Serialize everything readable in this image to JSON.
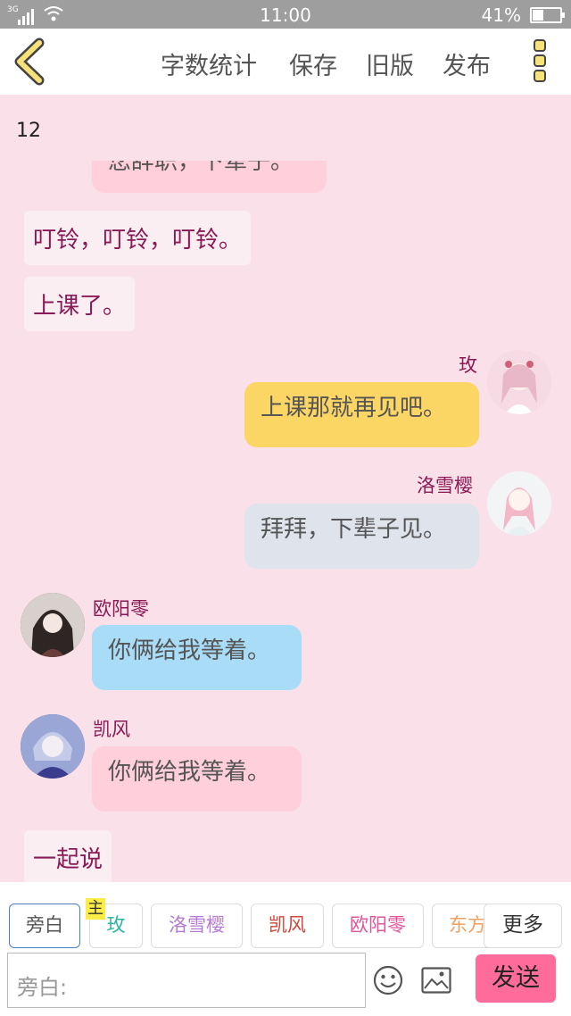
{
  "status_bar": {
    "network": "3G",
    "time": "11:00",
    "battery": "41%",
    "battery_level": 0.41
  },
  "toolbar": {
    "word_count": "字数统计",
    "save": "保存",
    "old_version": "旧版",
    "publish": "发布"
  },
  "counter": "12",
  "messages": [
    {
      "kind": "bubble_clipped",
      "text": "您辞职，下辈子。"
    },
    {
      "kind": "narration",
      "text": "叮铃，叮铃，叮铃。"
    },
    {
      "kind": "narration",
      "text": "上课了。"
    },
    {
      "kind": "right",
      "name": "玫",
      "text": "上课那就再见吧。",
      "color": "#fcd665"
    },
    {
      "kind": "right",
      "name": "洛雪樱",
      "text": "拜拜，下辈子见。",
      "color": "#dfe4ec"
    },
    {
      "kind": "left",
      "name": "欧阳零",
      "text": "你俩给我等着。",
      "color": "#a8dcf7"
    },
    {
      "kind": "left",
      "name": "凯风",
      "text": "你俩给我等着。",
      "color": "#ffcfdc"
    },
    {
      "kind": "narration",
      "text": "一起说"
    }
  ],
  "characters": [
    {
      "label": "旁白",
      "color": "#555555",
      "selected": true
    },
    {
      "label": "玫",
      "badge": "主",
      "color": "#2ab5a5"
    },
    {
      "label": "洛雪樱",
      "color": "#b47ad6"
    },
    {
      "label": "凯风",
      "color": "#d4453a"
    },
    {
      "label": "欧阳零",
      "color": "#e0569b"
    },
    {
      "label": "东方",
      "color": "#f0a060"
    }
  ],
  "more_label": "更多",
  "input": {
    "placeholder": "旁白:"
  },
  "send_label": "发送",
  "colors": {
    "background": "#fae0e8",
    "accent": "#ff6b9a",
    "name": "#8a1a55"
  }
}
